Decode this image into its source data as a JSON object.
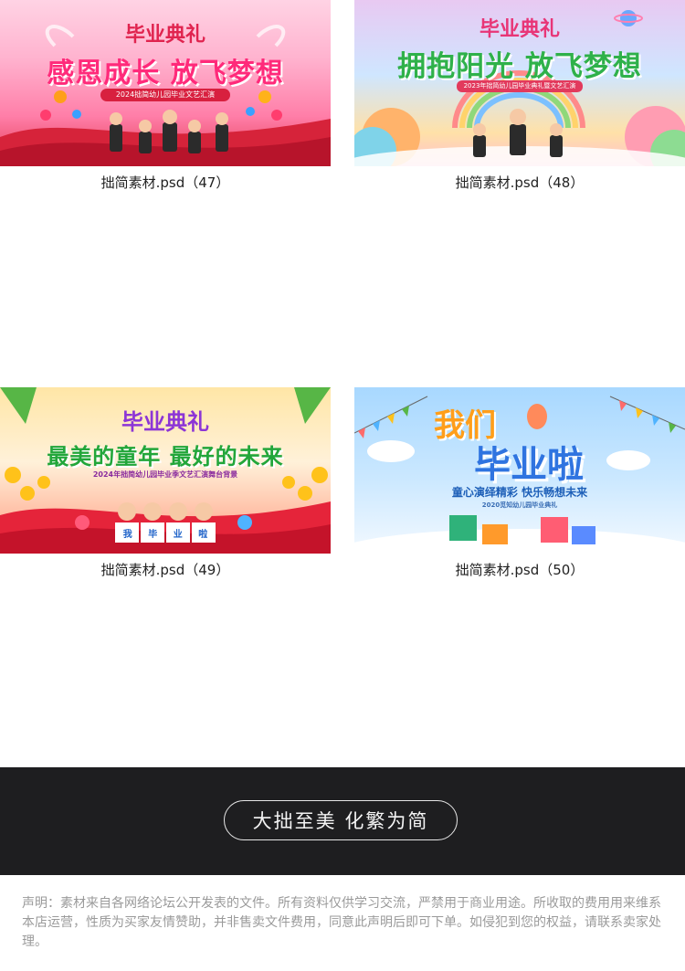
{
  "items": [
    {
      "caption": "拙简素材.psd（47）",
      "badge": "毕业典礼",
      "headline": "感恩成长 放飞梦想",
      "subtitle": "2024拙简幼儿园毕业文艺汇演"
    },
    {
      "caption": "拙简素材.psd（48）",
      "badge": "毕业典礼",
      "headline": "拥抱阳光 放飞梦想",
      "subtitle": "2023年拙简幼儿园毕业典礼暨文艺汇演"
    },
    {
      "caption": "拙简素材.psd（49）",
      "badge": "毕业典礼",
      "headline": "最美的童年 最好的未来",
      "subtitle": "2024年拙简幼儿园毕业季文艺汇演舞台背景",
      "sign_chars": [
        "我",
        "毕",
        "业",
        "啦"
      ]
    },
    {
      "caption": "拙简素材.psd（50）",
      "headline_line1": "我们",
      "headline_line2": "毕业啦",
      "subtitle": "童心演绎精彩 快乐畅想未来",
      "small_text": "2020觅知幼儿园毕业典礼"
    }
  ],
  "footer": {
    "slogan": "大拙至美 化繁为简",
    "disclaimer": "声明：素材来自各网络论坛公开发表的文件。所有资料仅供学习交流，严禁用于商业用途。所收取的费用用来维系本店运营，性质为买家友情赞助，并非售卖文件费用，同意此声明后即可下单。如侵犯到您的权益，请联系卖家处理。"
  },
  "colors": {
    "footer_bg": "#1e1e20",
    "caption_text": "#222222",
    "disclaimer_text": "#9a9a9a"
  }
}
